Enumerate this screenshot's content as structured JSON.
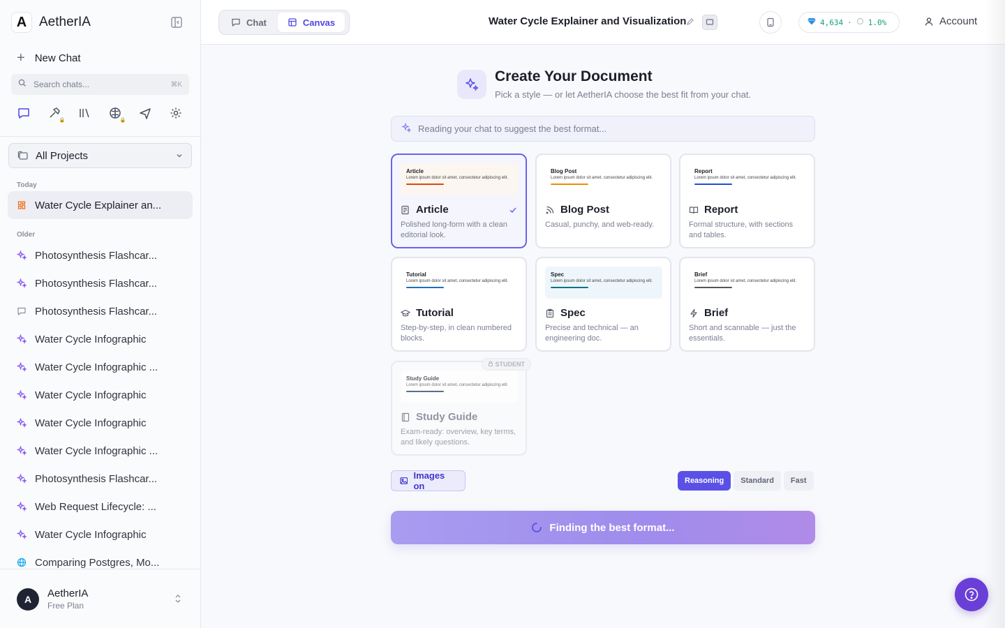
{
  "app": {
    "logo_letter": "A",
    "name": "AetherIA"
  },
  "sidebar": {
    "new_chat": "New Chat",
    "search_placeholder": "Search chats...",
    "search_shortcut": "⌘K",
    "projects": "All Projects",
    "today_label": "Today",
    "older_label": "Older",
    "today_items": [
      {
        "label": "Water Cycle Explainer an...",
        "icon": "canvas-doc-icon"
      }
    ],
    "older_items": [
      {
        "label": "Photosynthesis Flashcar...",
        "icon": "sparkle-icon"
      },
      {
        "label": "Photosynthesis Flashcar...",
        "icon": "sparkle-icon"
      },
      {
        "label": "Photosynthesis Flashcar...",
        "icon": "chat-bubble-icon"
      },
      {
        "label": "Water Cycle Infographic",
        "icon": "sparkle-icon"
      },
      {
        "label": "Water Cycle Infographic ...",
        "icon": "sparkle-icon"
      },
      {
        "label": "Water Cycle Infographic",
        "icon": "sparkle-icon"
      },
      {
        "label": "Water Cycle Infographic",
        "icon": "sparkle-icon"
      },
      {
        "label": "Water Cycle Infographic ...",
        "icon": "sparkle-icon"
      },
      {
        "label": "Photosynthesis Flashcar...",
        "icon": "sparkle-icon"
      },
      {
        "label": "Web Request Lifecycle: ...",
        "icon": "sparkle-icon"
      },
      {
        "label": "Water Cycle Infographic",
        "icon": "sparkle-icon"
      },
      {
        "label": "Comparing Postgres, Mo...",
        "icon": "globe-icon"
      }
    ],
    "user": {
      "initial": "A",
      "name": "AetherIA",
      "plan": "Free Plan"
    }
  },
  "header": {
    "tab_chat": "Chat",
    "tab_canvas": "Canvas",
    "title": "Water Cycle Explainer and Visualization",
    "credits": "4,634",
    "usage": "1.0%",
    "account": "Account"
  },
  "main": {
    "title": "Create Your Document",
    "subtitle": "Pick a style — or let AetherIA choose the best fit from your chat.",
    "status": "Reading your chat to suggest the best format...",
    "preview_body": "Lorem ipsum dolor sit amet, consectetur adipiscing elit.",
    "cards": [
      {
        "name": "Article",
        "desc": "Polished long-form with a clean editorial look.",
        "accent": "#d9480f",
        "preview_bg": "#fbf6ef"
      },
      {
        "name": "Blog Post",
        "desc": "Casual, punchy, and web-ready.",
        "accent": "#f08c00",
        "preview_bg": "#ffffff"
      },
      {
        "name": "Report",
        "desc": "Formal structure, with sections and tables.",
        "accent": "#1c4fd8",
        "preview_bg": "#ffffff"
      },
      {
        "name": "Tutorial",
        "desc": "Step-by-step, in clean numbered blocks.",
        "accent": "#1971c2",
        "preview_bg": "#ffffff"
      },
      {
        "name": "Spec",
        "desc": "Precise and technical — an engineering doc.",
        "accent": "#0b7285",
        "preview_bg": "#eef6fb"
      },
      {
        "name": "Brief",
        "desc": "Short and scannable — just the essentials.",
        "accent": "#555555",
        "preview_bg": "#ffffff"
      },
      {
        "name": "Study Guide",
        "desc": "Exam-ready: overview, key terms, and likely questions.",
        "accent": "#1e3a5f",
        "preview_bg": "#ffffff",
        "badge": "STUDENT"
      }
    ],
    "images_toggle": "Images on",
    "speed_options": [
      "Reasoning",
      "Standard",
      "Fast"
    ],
    "speed_selected": "Reasoning",
    "primary_button": "Finding the best format..."
  },
  "colors": {
    "accent": "#5b50e6",
    "credit_green": "#10a37f"
  }
}
